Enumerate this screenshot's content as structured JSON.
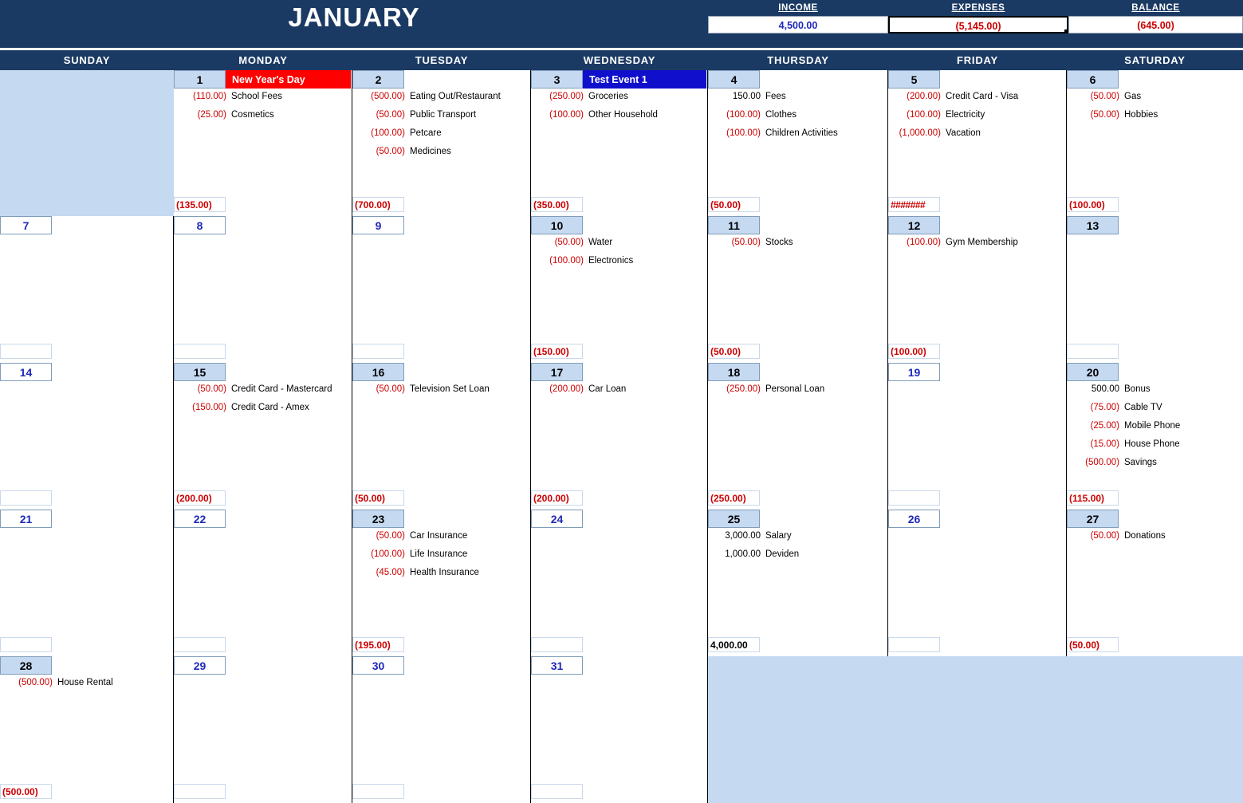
{
  "header": {
    "month_title": "JANUARY",
    "summary": [
      {
        "label": "INCOME",
        "value": "4,500.00",
        "sign": "pos",
        "focused": false
      },
      {
        "label": "EXPENSES",
        "value": "(5,145.00)",
        "sign": "neg",
        "focused": true
      },
      {
        "label": "BALANCE",
        "value": "(645.00)",
        "sign": "neg",
        "focused": false
      }
    ]
  },
  "weekdays": [
    "SUNDAY",
    "MONDAY",
    "TUESDAY",
    "WEDNESDAY",
    "THURSDAY",
    "FRIDAY",
    "SATURDAY"
  ],
  "colors": {
    "header_blue": "#1b3a63",
    "day_fill": "#c5d9f1",
    "negative": "#cc0000",
    "positive_number": "#1f29b8",
    "holiday_red": "#ff0000",
    "event_blue": "#1010cc"
  },
  "weeks": [
    {
      "days": [
        {
          "blank": true
        },
        {
          "num": "1",
          "active": true,
          "event": {
            "label": "New Year's Day",
            "color": "#ff0000"
          },
          "items": [
            {
              "amount": "(110.00)",
              "sign": "neg",
              "desc": "School Fees"
            },
            {
              "amount": "(25.00)",
              "sign": "neg",
              "desc": "Cosmetics"
            }
          ],
          "total": "(135.00)",
          "total_sign": "neg"
        },
        {
          "num": "2",
          "active": true,
          "items": [
            {
              "amount": "(500.00)",
              "sign": "neg",
              "desc": "Eating Out/Restaurant"
            },
            {
              "amount": "(50.00)",
              "sign": "neg",
              "desc": "Public Transport"
            },
            {
              "amount": "(100.00)",
              "sign": "neg",
              "desc": "Petcare"
            },
            {
              "amount": "(50.00)",
              "sign": "neg",
              "desc": "Medicines"
            }
          ],
          "total": "(700.00)",
          "total_sign": "neg"
        },
        {
          "num": "3",
          "active": true,
          "event": {
            "label": "Test Event 1",
            "color": "#1010cc"
          },
          "items": [
            {
              "amount": "(250.00)",
              "sign": "neg",
              "desc": "Groceries"
            },
            {
              "amount": "(100.00)",
              "sign": "neg",
              "desc": "Other Household"
            }
          ],
          "total": "(350.00)",
          "total_sign": "neg"
        },
        {
          "num": "4",
          "active": true,
          "items": [
            {
              "amount": "150.00",
              "sign": "pos",
              "desc": "Fees"
            },
            {
              "amount": "(100.00)",
              "sign": "neg",
              "desc": "Clothes"
            },
            {
              "amount": "(100.00)",
              "sign": "neg",
              "desc": "Children Activities"
            }
          ],
          "total": "(50.00)",
          "total_sign": "neg"
        },
        {
          "num": "5",
          "active": true,
          "items": [
            {
              "amount": "(200.00)",
              "sign": "neg",
              "desc": "Credit Card - Visa"
            },
            {
              "amount": "(100.00)",
              "sign": "neg",
              "desc": "Electricity"
            },
            {
              "amount": "(1,000.00)",
              "sign": "neg",
              "desc": "Vacation"
            }
          ],
          "total": "#######",
          "total_sign": "over"
        },
        {
          "num": "6",
          "active": true,
          "items": [
            {
              "amount": "(50.00)",
              "sign": "neg",
              "desc": "Gas"
            },
            {
              "amount": "(50.00)",
              "sign": "neg",
              "desc": "Hobbies"
            }
          ],
          "total": "(100.00)",
          "total_sign": "neg"
        }
      ]
    },
    {
      "days": [
        {
          "num": "7",
          "active": false,
          "items": [],
          "total": ""
        },
        {
          "num": "8",
          "active": false,
          "items": [],
          "total": ""
        },
        {
          "num": "9",
          "active": false,
          "items": [],
          "total": ""
        },
        {
          "num": "10",
          "active": true,
          "items": [
            {
              "amount": "(50.00)",
              "sign": "neg",
              "desc": "Water"
            },
            {
              "amount": "(100.00)",
              "sign": "neg",
              "desc": "Electronics"
            }
          ],
          "total": "(150.00)",
          "total_sign": "neg"
        },
        {
          "num": "11",
          "active": true,
          "items": [
            {
              "amount": "(50.00)",
              "sign": "neg",
              "desc": "Stocks"
            }
          ],
          "total": "(50.00)",
          "total_sign": "neg"
        },
        {
          "num": "12",
          "active": true,
          "items": [
            {
              "amount": "(100.00)",
              "sign": "neg",
              "desc": "Gym Membership"
            }
          ],
          "total": "(100.00)",
          "total_sign": "neg"
        },
        {
          "num": "13",
          "active": true,
          "items": [],
          "total": ""
        }
      ]
    },
    {
      "days": [
        {
          "num": "14",
          "active": false,
          "items": [],
          "total": ""
        },
        {
          "num": "15",
          "active": true,
          "items": [
            {
              "amount": "(50.00)",
              "sign": "neg",
              "desc": "Credit Card - Mastercard"
            },
            {
              "amount": "(150.00)",
              "sign": "neg",
              "desc": "Credit Card - Amex"
            }
          ],
          "total": "(200.00)",
          "total_sign": "neg"
        },
        {
          "num": "16",
          "active": true,
          "items": [
            {
              "amount": "(50.00)",
              "sign": "neg",
              "desc": "Television Set Loan"
            }
          ],
          "total": "(50.00)",
          "total_sign": "neg"
        },
        {
          "num": "17",
          "active": true,
          "items": [
            {
              "amount": "(200.00)",
              "sign": "neg",
              "desc": "Car Loan"
            }
          ],
          "total": "(200.00)",
          "total_sign": "neg"
        },
        {
          "num": "18",
          "active": true,
          "items": [
            {
              "amount": "(250.00)",
              "sign": "neg",
              "desc": "Personal Loan"
            }
          ],
          "total": "(250.00)",
          "total_sign": "neg"
        },
        {
          "num": "19",
          "active": false,
          "items": [],
          "total": ""
        },
        {
          "num": "20",
          "active": true,
          "items": [
            {
              "amount": "500.00",
              "sign": "pos",
              "desc": "Bonus"
            },
            {
              "amount": "(75.00)",
              "sign": "neg",
              "desc": "Cable TV"
            },
            {
              "amount": "(25.00)",
              "sign": "neg",
              "desc": "Mobile Phone"
            },
            {
              "amount": "(15.00)",
              "sign": "neg",
              "desc": "House Phone"
            },
            {
              "amount": "(500.00)",
              "sign": "neg",
              "desc": "Savings"
            }
          ],
          "total": "(115.00)",
          "total_sign": "neg"
        }
      ]
    },
    {
      "days": [
        {
          "num": "21",
          "active": false,
          "items": [],
          "total": ""
        },
        {
          "num": "22",
          "active": false,
          "items": [],
          "total": ""
        },
        {
          "num": "23",
          "active": true,
          "items": [
            {
              "amount": "(50.00)",
              "sign": "neg",
              "desc": "Car Insurance"
            },
            {
              "amount": "(100.00)",
              "sign": "neg",
              "desc": "Life Insurance"
            },
            {
              "amount": "(45.00)",
              "sign": "neg",
              "desc": "Health Insurance"
            }
          ],
          "total": "(195.00)",
          "total_sign": "neg"
        },
        {
          "num": "24",
          "active": false,
          "items": [],
          "total": ""
        },
        {
          "num": "25",
          "active": true,
          "items": [
            {
              "amount": "3,000.00",
              "sign": "pos",
              "desc": "Salary"
            },
            {
              "amount": "1,000.00",
              "sign": "pos",
              "desc": "Deviden"
            }
          ],
          "total": "4,000.00",
          "total_sign": "pos"
        },
        {
          "num": "26",
          "active": false,
          "items": [],
          "total": ""
        },
        {
          "num": "27",
          "active": true,
          "items": [
            {
              "amount": "(50.00)",
              "sign": "neg",
              "desc": "Donations"
            }
          ],
          "total": "(50.00)",
          "total_sign": "neg"
        }
      ]
    },
    {
      "days": [
        {
          "num": "28",
          "active": true,
          "items": [
            {
              "amount": "(500.00)",
              "sign": "neg",
              "desc": "House Rental"
            }
          ],
          "total": "(500.00)",
          "total_sign": "neg"
        },
        {
          "num": "29",
          "active": false,
          "items": [],
          "total": ""
        },
        {
          "num": "30",
          "active": false,
          "items": [],
          "total": ""
        },
        {
          "num": "31",
          "active": false,
          "items": [],
          "total": ""
        },
        {
          "blank": true
        },
        {
          "blank": true
        },
        {
          "blank": true
        }
      ]
    }
  ]
}
